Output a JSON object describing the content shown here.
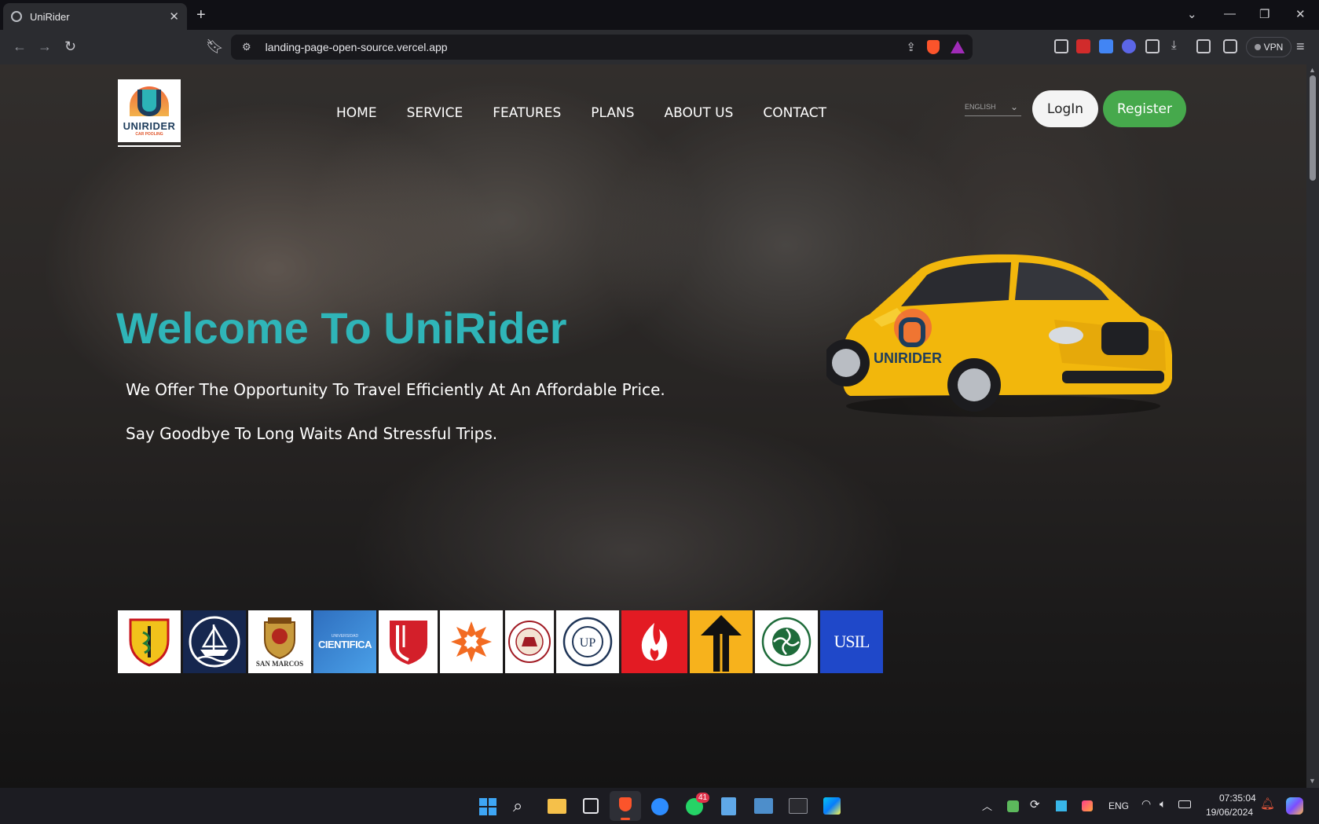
{
  "browser": {
    "tab_title": "UniRider",
    "url": "landing-page-open-source.vercel.app",
    "vpn_label": "VPN"
  },
  "header": {
    "logo_text": "UNIRIDER",
    "logo_subtext": "CAR POOLING",
    "nav": [
      "HOME",
      "SERVICE",
      "FEATURES",
      "PLANS",
      "ABOUT US",
      "CONTACT"
    ],
    "language": "ENGLISH",
    "login_label": "LogIn",
    "register_label": "Register"
  },
  "hero": {
    "title": "Welcome To UniRider",
    "line1": "We Offer The Opportunity To Travel Efficiently At An Affordable Price.",
    "line2": "Say Goodbye To Long Waits And Stressful Trips.",
    "car_logo_text": "UNIRIDER"
  },
  "universities": {
    "san_marcos_text": "SAN MARCOS",
    "cientifica_top": "UNIVERSIDAD",
    "cientifica_text": "CIENTIFICA",
    "usil_text": "USIL",
    "pacifico_text": "UP"
  },
  "taskbar": {
    "whatsapp_badge": "41",
    "language": "ENG",
    "time": "07:35:04",
    "date": "19/06/2024"
  },
  "colors": {
    "accent": "#2fb5b8",
    "register": "#46a94c"
  }
}
